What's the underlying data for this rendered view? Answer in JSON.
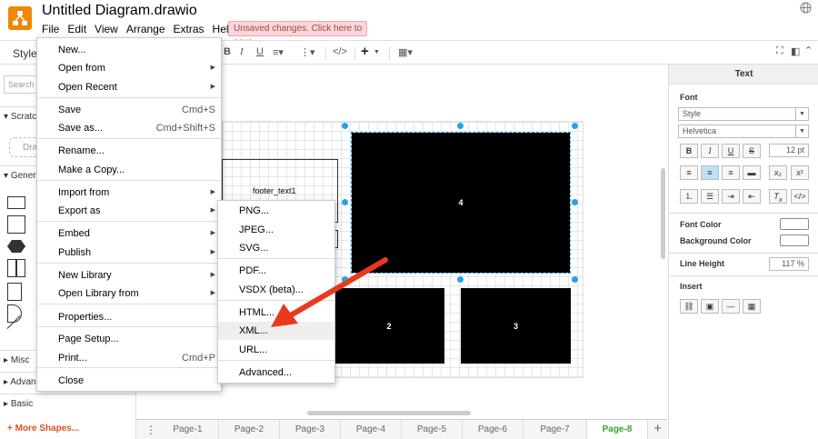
{
  "app": {
    "title": "Untitled Diagram.drawio",
    "unsaved": "Unsaved changes. Click here to save.",
    "brand_color": "#f08705"
  },
  "menubar": [
    "File",
    "Edit",
    "View",
    "Arrange",
    "Extras",
    "Help"
  ],
  "toolbar": {
    "style_tab": "Style",
    "code_icon": "</>",
    "plus_icon": "+"
  },
  "leftpanel": {
    "search_placeholder": "Search",
    "sections": {
      "scratchpad": "Scratch",
      "general": "General",
      "misc": "Misc",
      "advanced": "Advanc",
      "basic": "Basic"
    },
    "drag_label": "Dra",
    "more_shapes": "+ More Shapes..."
  },
  "file_menu": [
    {
      "label": "New...",
      "shortcut": "",
      "submenu": false
    },
    {
      "label": "Open from",
      "shortcut": "",
      "submenu": true
    },
    {
      "label": "Open Recent",
      "shortcut": "",
      "submenu": true
    },
    {
      "label": "Save",
      "shortcut": "Cmd+S",
      "submenu": false
    },
    {
      "label": "Save as...",
      "shortcut": "Cmd+Shift+S",
      "submenu": false
    },
    {
      "label": "Rename...",
      "shortcut": "",
      "submenu": false
    },
    {
      "label": "Make a Copy...",
      "shortcut": "",
      "submenu": false
    },
    {
      "label": "Import from",
      "shortcut": "",
      "submenu": true
    },
    {
      "label": "Export as",
      "shortcut": "",
      "submenu": true
    },
    {
      "label": "Embed",
      "shortcut": "",
      "submenu": true
    },
    {
      "label": "Publish",
      "shortcut": "",
      "submenu": true
    },
    {
      "label": "New Library",
      "shortcut": "",
      "submenu": true
    },
    {
      "label": "Open Library from",
      "shortcut": "",
      "submenu": true
    },
    {
      "label": "Properties...",
      "shortcut": "",
      "submenu": false
    },
    {
      "label": "Page Setup...",
      "shortcut": "",
      "submenu": false
    },
    {
      "label": "Print...",
      "shortcut": "Cmd+P",
      "submenu": false
    },
    {
      "label": "Close",
      "shortcut": "",
      "submenu": false
    }
  ],
  "export_menu": [
    {
      "label": "PNG..."
    },
    {
      "label": "JPEG..."
    },
    {
      "label": "SVG..."
    },
    {
      "label": "PDF..."
    },
    {
      "label": "VSDX (beta)..."
    },
    {
      "label": "HTML..."
    },
    {
      "label": "XML..."
    },
    {
      "label": "URL..."
    },
    {
      "label": "Advanced..."
    }
  ],
  "canvas": {
    "footer_text": "footer_text1",
    "boxes": [
      "4",
      "2",
      "3"
    ],
    "arrow_color": "#e8391d",
    "selection_color": "#29a1e9"
  },
  "pages": [
    "Page-1",
    "Page-2",
    "Page-3",
    "Page-4",
    "Page-5",
    "Page-6",
    "Page-7",
    "Page-8"
  ],
  "active_page": "Page-8",
  "rightpanel": {
    "title": "Text",
    "font_header": "Font",
    "style_select": "Style",
    "font_select": "Helvetica",
    "font_size": "12 pt",
    "font_color": "Font Color",
    "background_color": "Background Color",
    "line_height": "Line Height",
    "line_height_value": "117 %",
    "insert_header": "Insert",
    "format_buttons": [
      "B",
      "I",
      "U",
      "S"
    ],
    "subsup": [
      "x₂",
      "x²"
    ],
    "code_btn": "</>"
  }
}
